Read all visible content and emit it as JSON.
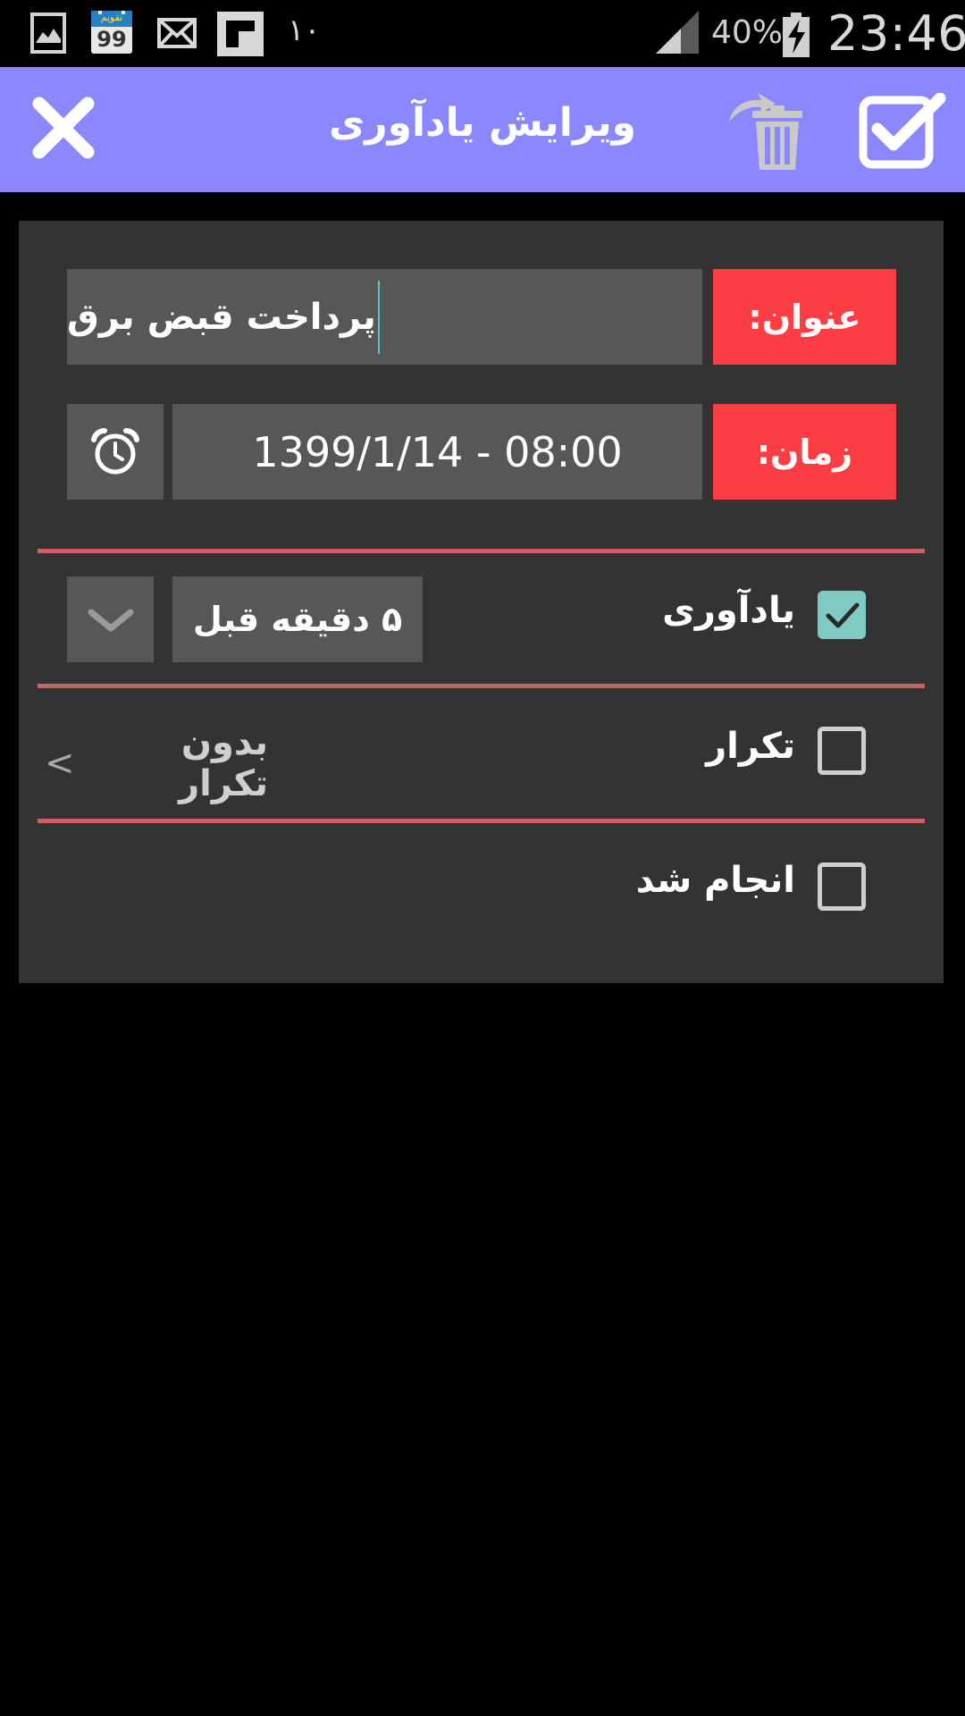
{
  "status_bar": {
    "notification_count": "١٠",
    "calendar_badge_text": "تقویم",
    "calendar_badge_number": "99",
    "battery_percent": "40%",
    "time": "23:46"
  },
  "header": {
    "title": "ویرایش یادآوری",
    "accent_color": "#8a87ff"
  },
  "form": {
    "title_label": "عنوان:",
    "title_value": "پرداخت قبض برق",
    "time_label": "زمان:",
    "time_value": "1399/1/14 - 08:00",
    "reminder": {
      "label": "یادآوری",
      "checked": true,
      "selected_option": "۵ دقیقه قبل"
    },
    "repeat": {
      "label": "تکرار",
      "checked": false,
      "value": "بدون تکرار",
      "chevron": "<"
    },
    "done": {
      "label": "انجام شد",
      "checked": false
    }
  },
  "icons": {
    "close": "close-icon",
    "delete": "trash-icon",
    "save": "checkbox-check-icon",
    "alarm": "alarm-clock-icon",
    "dropdown": "chevron-down-icon"
  },
  "colors": {
    "label_bg": "#fc3d43",
    "field_bg": "#575757",
    "card_bg": "#333333",
    "divider": "#c86163",
    "checkbox_checked": "#7fcbc4"
  }
}
